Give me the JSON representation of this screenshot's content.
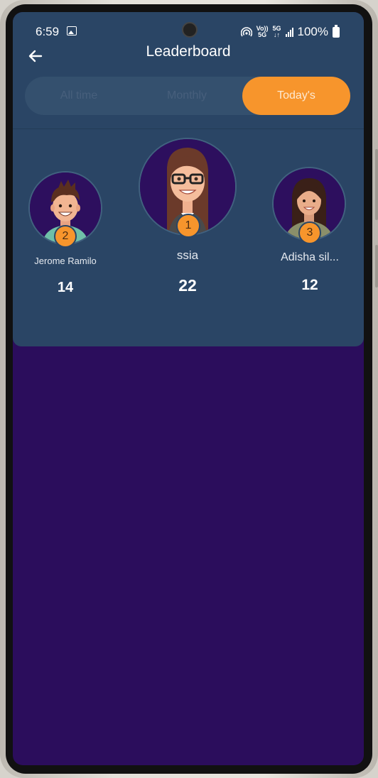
{
  "status_bar": {
    "time": "6:59",
    "battery": "100%",
    "network_top": "Vo))",
    "network_bottom": "5G",
    "data_top": "5G",
    "data_bottom": "↓↑"
  },
  "header": {
    "title": "Leaderboard",
    "back_icon": "arrow-left-icon"
  },
  "tabs": [
    {
      "label": "All time",
      "active": false
    },
    {
      "label": "Monthly",
      "active": false
    },
    {
      "label": "Today's",
      "active": true
    }
  ],
  "podium": [
    {
      "rank": "1",
      "name": "ssia",
      "score": "22"
    },
    {
      "rank": "2",
      "name": "Jerome Ramilo",
      "score": "14"
    },
    {
      "rank": "3",
      "name": "Adisha sil...",
      "score": "12"
    }
  ],
  "colors": {
    "header_bg": "#2a4565",
    "page_bg": "#2b0d5c",
    "accent": "#f7952c",
    "tab_track": "#34506e"
  }
}
